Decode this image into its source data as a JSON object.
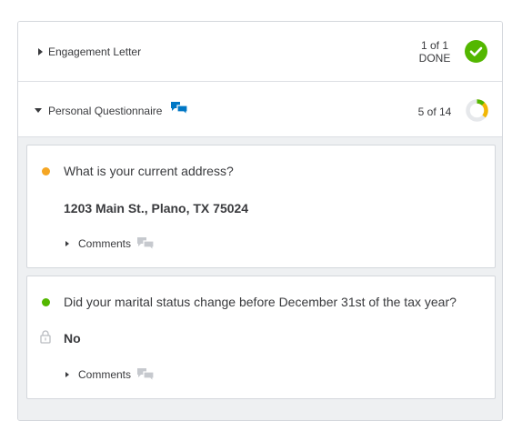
{
  "sections": [
    {
      "title": "Engagement Letter",
      "count": "1 of 1",
      "status": "DONE",
      "expanded": false,
      "status_icon": "check-circle-icon",
      "status_color": "#53b700"
    },
    {
      "title": "Personal Questionnaire",
      "count": "5 of 14",
      "expanded": true,
      "chat_icon": "comments-icon",
      "chat_icon_color": "#0077c5",
      "progress_fraction": 0.36,
      "progress_color": "#f2b705"
    }
  ],
  "questions": [
    {
      "status_color": "#f5a623",
      "question": "What is your current address?",
      "answer": "1203 Main St., Plano, TX 75024",
      "comments_label": "Comments",
      "locked": false
    },
    {
      "status_color": "#53b700",
      "question": "Did your marital status change before December 31st of the tax year?",
      "answer": "No",
      "comments_label": "Comments",
      "locked": true
    }
  ]
}
